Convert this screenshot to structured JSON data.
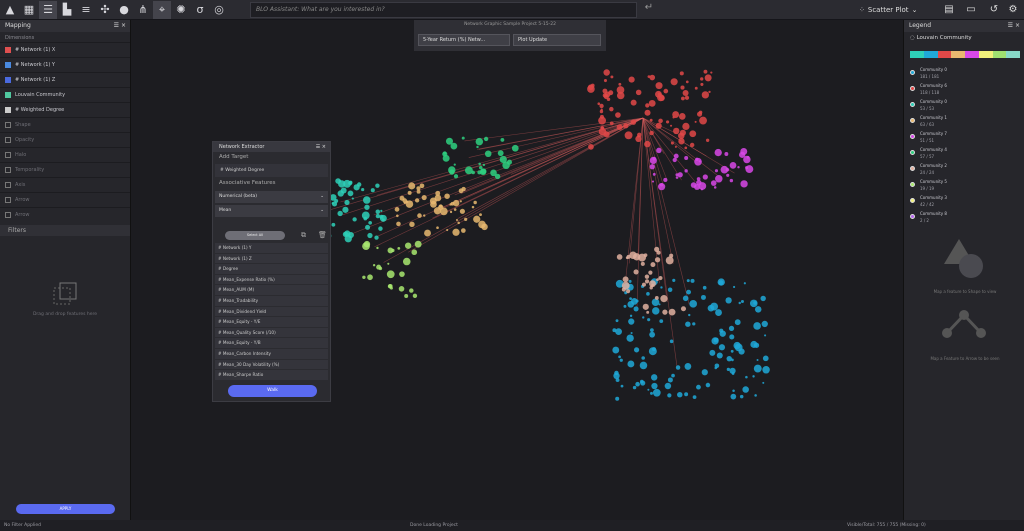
{
  "toolbar": {
    "search_placeholder": "BLO Assistant: What are you interested in?",
    "chart_type": "Scatter Plot"
  },
  "left_panel": {
    "title": "Mapping",
    "dimensions_label": "Dimensions",
    "dimensions": [
      {
        "label": "# Network (1) X",
        "color": "#e05050",
        "active": true
      },
      {
        "label": "# Network (1) Y",
        "color": "#4a8ae0",
        "active": true
      },
      {
        "label": "# Network (1) Z",
        "color": "#4a6ae0",
        "active": true
      },
      {
        "label": "Louvain Community",
        "color": "#50c8a0",
        "active": true
      },
      {
        "label": "# Weighted Degree",
        "color": "#cccccc",
        "active": true
      },
      {
        "label": "Shape",
        "color": "#777777",
        "active": false
      },
      {
        "label": "Opacity",
        "color": "#777777",
        "active": false
      },
      {
        "label": "Halo",
        "color": "#777777",
        "active": false
      },
      {
        "label": "Temporality",
        "color": "#777777",
        "active": false
      },
      {
        "label": "Axis",
        "color": "#777777",
        "active": false
      },
      {
        "label": "Arrow",
        "color": "#777777",
        "active": false
      },
      {
        "label": "Arrow",
        "color": "#777777",
        "active": false
      }
    ],
    "filters_title": "Filters",
    "filters_hint": "Drag and drop features here",
    "apply_label": "APPLY"
  },
  "top_dropdowns": {
    "project": "Network Graphic Sample Project 5-15-22",
    "metric": "5-Year Return (%) Netw...",
    "update": "Plot Update"
  },
  "extractor": {
    "title": "Network Extractor",
    "add_target": "Add Target",
    "target": "# Weighted Degree",
    "assoc_label": "Associative Features",
    "type": "Numerical (beta)",
    "agg": "Mean",
    "select_all": "Select All",
    "features": [
      "# Network (1) Y",
      "# Network (1) Z",
      "# Degree",
      "# Mean_Expense Ratio (%)",
      "# Mean_AUM (M)",
      "# Mean_Tradability",
      "# Mean_Dividend Yield",
      "# Mean_Equity - Y/E",
      "# Mean_Quality Score (/10)",
      "# Mean_Equity - Y/B",
      "# Mean_Carbon Intensity",
      "# Mean_30 Day Volatility (%)",
      "# Mean_Sharpe Ratio"
    ],
    "run_label": "Walk"
  },
  "legend": {
    "title": "Legend",
    "attr": "Louvain Community",
    "strip": [
      "#2ed0b8",
      "#1fa8d8",
      "#e04848",
      "#e8b870",
      "#d848e8",
      "#f0f07a",
      "#a0e070",
      "#88d8c8"
    ],
    "items": [
      {
        "name": "Community 0",
        "count": "181 / 181",
        "color": "#1fa8d8"
      },
      {
        "name": "Community 6",
        "count": "118 / 118",
        "color": "#e04848"
      },
      {
        "name": "Community 0",
        "count": "53 / 53",
        "color": "#2ed0b8"
      },
      {
        "name": "Community 1",
        "count": "63 / 63",
        "color": "#e8b870"
      },
      {
        "name": "Community 7",
        "count": "51 / 51",
        "color": "#d848e8"
      },
      {
        "name": "Community 4",
        "count": "57 / 57",
        "color": "#2ed080"
      },
      {
        "name": "Community 2",
        "count": "24 / 24",
        "color": "#e0b0a0"
      },
      {
        "name": "Community 5",
        "count": "19 / 19",
        "color": "#a8e870"
      },
      {
        "name": "Community 3",
        "count": "42 / 42",
        "color": "#f0f07a"
      },
      {
        "name": "Community 8",
        "count": "2 / 2",
        "color": "#b868f0"
      }
    ],
    "shape_hint": "Map a feature to Shape to view",
    "arrow_hint": "Map a Feature to Arrow to be seen"
  },
  "status": {
    "left": "No Filter Applied",
    "center": "Done Loading Project",
    "right": "Visible/Total: 755 / 755 (Missing: 0)"
  },
  "colors": {
    "accent": "#5a6af0",
    "background": "#1c1c20",
    "panel": "#26262b"
  }
}
